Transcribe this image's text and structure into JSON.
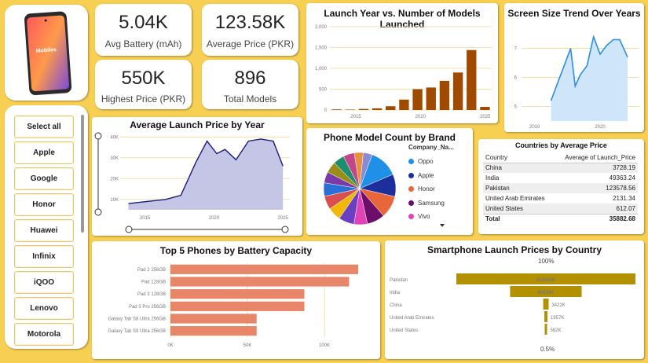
{
  "logo": {
    "text": "Mobiles"
  },
  "kpis": [
    {
      "value": "5.04K",
      "label": "Avg Battery (mAh)"
    },
    {
      "value": "123.58K",
      "label": "Average Price (PKR)"
    },
    {
      "value": "550K",
      "label": "Highest Price (PKR)"
    },
    {
      "value": "896",
      "label": "Total Models"
    }
  ],
  "slicer": {
    "items": [
      "Select all",
      "Apple",
      "Google",
      "Honor",
      "Huawei",
      "Infinix",
      "iQOO",
      "Lenovo",
      "Motorola"
    ]
  },
  "launch_year_chart": {
    "title": "Launch Year vs. Number of Models Launched",
    "color": "#a04a00",
    "chart_data": {
      "type": "bar",
      "x": [
        2014,
        2016,
        2017,
        2018,
        2019,
        2020,
        2021,
        2022,
        2023,
        2024,
        2025
      ],
      "values": [
        15,
        10,
        25,
        40,
        90,
        250,
        500,
        540,
        700,
        900,
        1440,
        75
      ],
      "y_ticks": [
        "0",
        "500",
        "1,000",
        "1,500",
        "2,000"
      ],
      "x_ticks": [
        "2015",
        "2020",
        "2025"
      ],
      "ylim": [
        0,
        2000
      ]
    }
  },
  "screen_size_chart": {
    "title": "Screen Size Trend Over Years",
    "color": "#2b8ee0",
    "fill": "#cfe6fa",
    "chart_data": {
      "type": "area",
      "x": [
        2013,
        2014,
        2015,
        2016,
        2017,
        2018,
        2019,
        2020,
        2021,
        2022,
        2023,
        2024,
        2025
      ],
      "values": [
        5.2,
        6.1,
        7.0,
        5.7,
        6.1,
        6.4,
        7.4,
        6.8,
        7.1,
        7.3,
        7.3,
        6.7
      ],
      "y_ticks": [
        "5",
        "6",
        "7"
      ],
      "x_ticks": [
        "2010",
        "2020"
      ],
      "ylim": [
        4.5,
        7.8
      ]
    }
  },
  "avg_price_chart": {
    "title": "Average Launch Price by Year",
    "color": "#1a1a80",
    "fill": "#c5c5e6",
    "chart_data": {
      "type": "area",
      "x": [
        2014,
        2016,
        2017,
        2018,
        2019,
        2020,
        2021,
        2022,
        2023,
        2024,
        2025
      ],
      "values": [
        8000,
        10000,
        12000,
        28000,
        38000,
        32000,
        34000,
        29000,
        38000,
        39000,
        38000,
        26000
      ],
      "y_ticks": [
        "10K",
        "20K",
        "30K",
        "40K"
      ],
      "x_ticks": [
        "2015",
        "2020",
        "2025"
      ],
      "ylim": [
        5000,
        42000
      ]
    }
  },
  "brand_pie": {
    "title": "Phone Model Count by Brand",
    "legend_title": "Company_Na...",
    "legend": [
      {
        "name": "Oppo",
        "color": "#1e90e8"
      },
      {
        "name": "Apple",
        "color": "#1c2f9c"
      },
      {
        "name": "Honor",
        "color": "#e8663a"
      },
      {
        "name": "Samsung",
        "color": "#6b0f6b"
      },
      {
        "name": "Vivo",
        "color": "#e043b8"
      }
    ],
    "chart_data": {
      "type": "pie",
      "categories": [
        "Oppo",
        "Apple",
        "Honor",
        "Samsung",
        "Vivo",
        "Other 1",
        "Other 2",
        "Other 3",
        "Other 4",
        "Other 5",
        "Other 6",
        "Other 7",
        "Other 8",
        "Other 9",
        "Other 10"
      ],
      "values": [
        13,
        10,
        10,
        8,
        6,
        7,
        6,
        6,
        6,
        5,
        5,
        5,
        5,
        4,
        4
      ],
      "colors": [
        "#1e90e8",
        "#1c2f9c",
        "#e8663a",
        "#6b0f6b",
        "#e043b8",
        "#6a3fc2",
        "#f2b807",
        "#d94f4f",
        "#2a6fd8",
        "#7a3aa8",
        "#9a8e1a",
        "#1e8f6e",
        "#c4468a",
        "#e8903c",
        "#8a8ad8"
      ]
    }
  },
  "countries_table": {
    "title": "Countries by Average Price",
    "headers": [
      "Country",
      "Average of Launch_Price"
    ],
    "rows": [
      [
        "China",
        "3728.19"
      ],
      [
        "India",
        "49363.24"
      ],
      [
        "Pakistan",
        "123578.56"
      ],
      [
        "United Arab Emirates",
        "2131.34"
      ],
      [
        "United States",
        "612.07"
      ]
    ],
    "total": [
      "Total",
      "35882.68"
    ]
  },
  "battery_chart": {
    "title": "Top 5 Phones by Battery Capacity",
    "color": "#e8866a",
    "chart_data": {
      "type": "bar",
      "categories": [
        "Pad 2 256GB",
        "Pad 128GB",
        "Pad 3 128GB",
        "Pad 3 Pro 256GB",
        "Galaxy Tab S8 Ultra 256GB",
        "Galaxy Tab S9 Ultra 256GB"
      ],
      "values": [
        122000,
        116000,
        87000,
        87000,
        56000,
        56000
      ],
      "x_ticks": [
        "0K",
        "50K",
        "100K"
      ],
      "xlim": [
        0,
        125000
      ]
    }
  },
  "funnel_chart": {
    "title": "Smartphone Launch Prices by Country",
    "top_label": "100%",
    "bottom_label": "0.5%",
    "color": "#b39000",
    "chart_data": {
      "type": "bar",
      "categories": [
        "Pakistan",
        "India",
        "China",
        "United Arab Emirates",
        "United States"
      ],
      "values": [
        113445,
        45315,
        3422,
        1957,
        562
      ],
      "labels": [
        "113445K",
        "45315K",
        "3422K",
        "1957K",
        "562K"
      ]
    }
  }
}
